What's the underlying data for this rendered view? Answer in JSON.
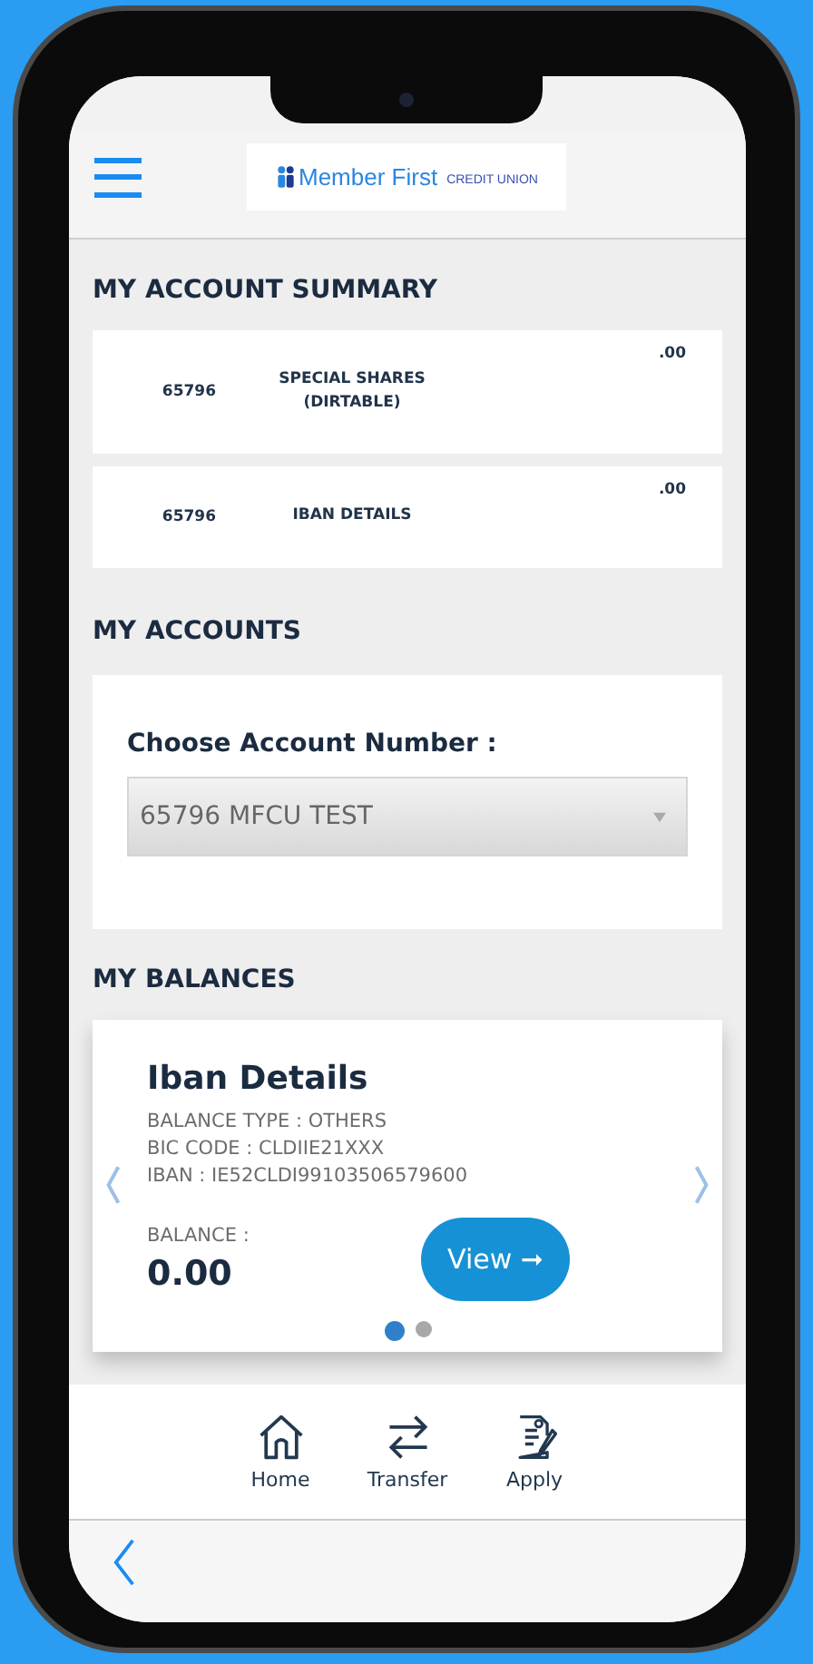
{
  "header": {
    "logo": {
      "name": "Member First",
      "tagline": "CREDIT UNION"
    }
  },
  "account_summary": {
    "title": "MY ACCOUNT SUMMARY",
    "rows": [
      {
        "number": "65796",
        "name": "SPECIAL SHARES (DIRTABLE)",
        "amount": ".00"
      },
      {
        "number": "65796",
        "name": "IBAN DETAILS",
        "amount": ".00"
      }
    ]
  },
  "my_accounts": {
    "title": "MY ACCOUNTS",
    "label": "Choose Account Number :",
    "select_value": "65796 MFCU TEST"
  },
  "my_balances": {
    "title": "MY BALANCES",
    "card": {
      "title": "Iban Details",
      "details": [
        "BALANCE TYPE : OTHERS",
        "BIC CODE : CLDIIE21XXX",
        "IBAN : IE52CLDI99103506579600"
      ],
      "balance_label": "BALANCE :",
      "balance": "0.00",
      "button": "View ➞"
    },
    "dots": [
      {
        "selected": true
      },
      {
        "selected": false
      }
    ]
  },
  "bottom_nav": [
    {
      "kind": "home",
      "label": "Home"
    },
    {
      "kind": "transfer",
      "label": "Transfer"
    },
    {
      "kind": "apply",
      "label": "Apply"
    }
  ]
}
